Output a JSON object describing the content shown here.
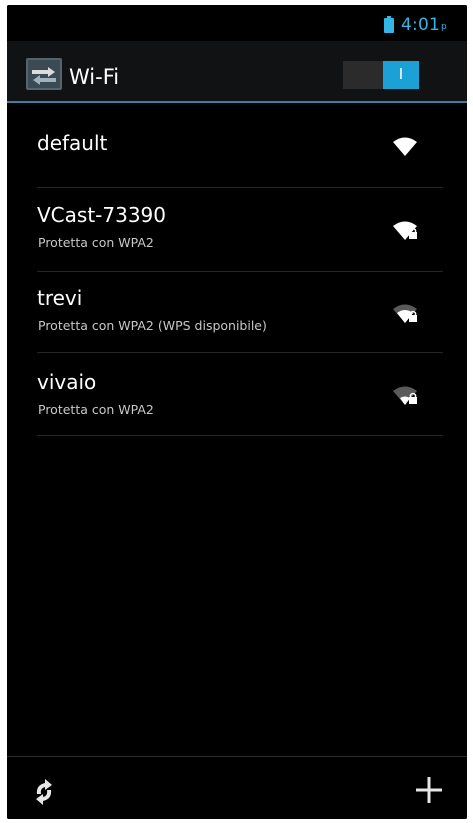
{
  "status_bar": {
    "time": "4:01",
    "time_suffix": "p",
    "battery_icon": "battery-icon",
    "accent_color": "#33b5e5"
  },
  "action_bar": {
    "title": "Wi-Fi",
    "app_icon": "wifi-settings-icon",
    "toggle_label": "I",
    "toggle_state": "on",
    "toggle_color": "#1ba1d6"
  },
  "networks": [
    {
      "name": "default",
      "security": "",
      "icon": "wifi-signal-icon",
      "locked": false
    },
    {
      "name": "VCast-73390",
      "security": "Protetta con WPA2",
      "icon": "wifi-signal-locked-icon",
      "locked": true
    },
    {
      "name": "trevi",
      "security": "Protetta con WPA2 (WPS disponibile)",
      "icon": "wifi-signal-locked-icon",
      "locked": true
    },
    {
      "name": "vivaio",
      "security": "Protetta con WPA2",
      "icon": "wifi-signal-locked-icon",
      "locked": true
    }
  ],
  "bottom_bar": {
    "scan_icon": "refresh-icon",
    "add_icon": "add-icon"
  }
}
